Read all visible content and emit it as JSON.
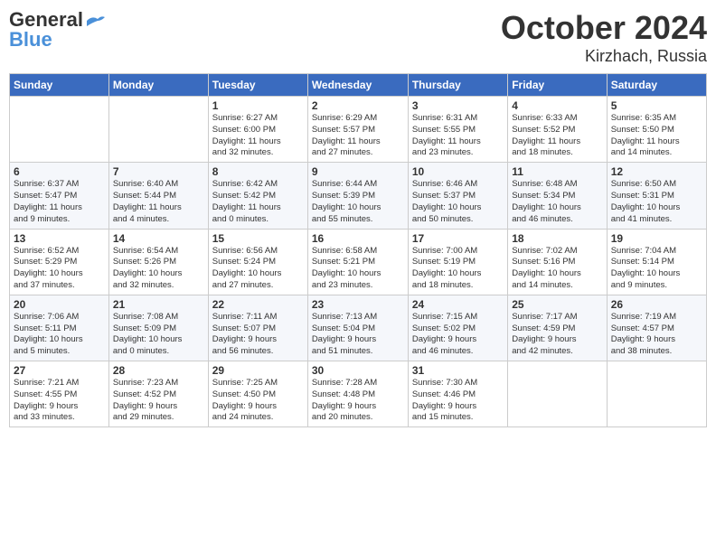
{
  "header": {
    "logo": {
      "line1": "General",
      "line2": "Blue"
    },
    "title": "October 2024",
    "subtitle": "Kirzhach, Russia"
  },
  "weekdays": [
    "Sunday",
    "Monday",
    "Tuesday",
    "Wednesday",
    "Thursday",
    "Friday",
    "Saturday"
  ],
  "weeks": [
    [
      {
        "day": "",
        "info": ""
      },
      {
        "day": "",
        "info": ""
      },
      {
        "day": "1",
        "info": "Sunrise: 6:27 AM\nSunset: 6:00 PM\nDaylight: 11 hours\nand 32 minutes."
      },
      {
        "day": "2",
        "info": "Sunrise: 6:29 AM\nSunset: 5:57 PM\nDaylight: 11 hours\nand 27 minutes."
      },
      {
        "day": "3",
        "info": "Sunrise: 6:31 AM\nSunset: 5:55 PM\nDaylight: 11 hours\nand 23 minutes."
      },
      {
        "day": "4",
        "info": "Sunrise: 6:33 AM\nSunset: 5:52 PM\nDaylight: 11 hours\nand 18 minutes."
      },
      {
        "day": "5",
        "info": "Sunrise: 6:35 AM\nSunset: 5:50 PM\nDaylight: 11 hours\nand 14 minutes."
      }
    ],
    [
      {
        "day": "6",
        "info": "Sunrise: 6:37 AM\nSunset: 5:47 PM\nDaylight: 11 hours\nand 9 minutes."
      },
      {
        "day": "7",
        "info": "Sunrise: 6:40 AM\nSunset: 5:44 PM\nDaylight: 11 hours\nand 4 minutes."
      },
      {
        "day": "8",
        "info": "Sunrise: 6:42 AM\nSunset: 5:42 PM\nDaylight: 11 hours\nand 0 minutes."
      },
      {
        "day": "9",
        "info": "Sunrise: 6:44 AM\nSunset: 5:39 PM\nDaylight: 10 hours\nand 55 minutes."
      },
      {
        "day": "10",
        "info": "Sunrise: 6:46 AM\nSunset: 5:37 PM\nDaylight: 10 hours\nand 50 minutes."
      },
      {
        "day": "11",
        "info": "Sunrise: 6:48 AM\nSunset: 5:34 PM\nDaylight: 10 hours\nand 46 minutes."
      },
      {
        "day": "12",
        "info": "Sunrise: 6:50 AM\nSunset: 5:31 PM\nDaylight: 10 hours\nand 41 minutes."
      }
    ],
    [
      {
        "day": "13",
        "info": "Sunrise: 6:52 AM\nSunset: 5:29 PM\nDaylight: 10 hours\nand 37 minutes."
      },
      {
        "day": "14",
        "info": "Sunrise: 6:54 AM\nSunset: 5:26 PM\nDaylight: 10 hours\nand 32 minutes."
      },
      {
        "day": "15",
        "info": "Sunrise: 6:56 AM\nSunset: 5:24 PM\nDaylight: 10 hours\nand 27 minutes."
      },
      {
        "day": "16",
        "info": "Sunrise: 6:58 AM\nSunset: 5:21 PM\nDaylight: 10 hours\nand 23 minutes."
      },
      {
        "day": "17",
        "info": "Sunrise: 7:00 AM\nSunset: 5:19 PM\nDaylight: 10 hours\nand 18 minutes."
      },
      {
        "day": "18",
        "info": "Sunrise: 7:02 AM\nSunset: 5:16 PM\nDaylight: 10 hours\nand 14 minutes."
      },
      {
        "day": "19",
        "info": "Sunrise: 7:04 AM\nSunset: 5:14 PM\nDaylight: 10 hours\nand 9 minutes."
      }
    ],
    [
      {
        "day": "20",
        "info": "Sunrise: 7:06 AM\nSunset: 5:11 PM\nDaylight: 10 hours\nand 5 minutes."
      },
      {
        "day": "21",
        "info": "Sunrise: 7:08 AM\nSunset: 5:09 PM\nDaylight: 10 hours\nand 0 minutes."
      },
      {
        "day": "22",
        "info": "Sunrise: 7:11 AM\nSunset: 5:07 PM\nDaylight: 9 hours\nand 56 minutes."
      },
      {
        "day": "23",
        "info": "Sunrise: 7:13 AM\nSunset: 5:04 PM\nDaylight: 9 hours\nand 51 minutes."
      },
      {
        "day": "24",
        "info": "Sunrise: 7:15 AM\nSunset: 5:02 PM\nDaylight: 9 hours\nand 46 minutes."
      },
      {
        "day": "25",
        "info": "Sunrise: 7:17 AM\nSunset: 4:59 PM\nDaylight: 9 hours\nand 42 minutes."
      },
      {
        "day": "26",
        "info": "Sunrise: 7:19 AM\nSunset: 4:57 PM\nDaylight: 9 hours\nand 38 minutes."
      }
    ],
    [
      {
        "day": "27",
        "info": "Sunrise: 7:21 AM\nSunset: 4:55 PM\nDaylight: 9 hours\nand 33 minutes."
      },
      {
        "day": "28",
        "info": "Sunrise: 7:23 AM\nSunset: 4:52 PM\nDaylight: 9 hours\nand 29 minutes."
      },
      {
        "day": "29",
        "info": "Sunrise: 7:25 AM\nSunset: 4:50 PM\nDaylight: 9 hours\nand 24 minutes."
      },
      {
        "day": "30",
        "info": "Sunrise: 7:28 AM\nSunset: 4:48 PM\nDaylight: 9 hours\nand 20 minutes."
      },
      {
        "day": "31",
        "info": "Sunrise: 7:30 AM\nSunset: 4:46 PM\nDaylight: 9 hours\nand 15 minutes."
      },
      {
        "day": "",
        "info": ""
      },
      {
        "day": "",
        "info": ""
      }
    ]
  ]
}
